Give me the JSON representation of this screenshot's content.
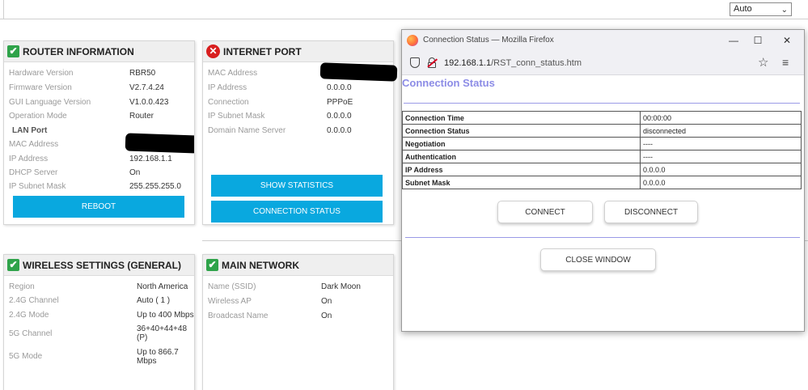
{
  "language_select": {
    "value": "Auto"
  },
  "router_info": {
    "title": "ROUTER INFORMATION",
    "rows": [
      {
        "label": "Hardware Version",
        "value": "RBR50"
      },
      {
        "label": "Firmware Version",
        "value": "V2.7.4.24"
      },
      {
        "label": "GUI Language Version",
        "value": "V1.0.0.423"
      },
      {
        "label": "Operation Mode",
        "value": "Router"
      }
    ],
    "lan_heading": "LAN Port",
    "lan_rows": [
      {
        "label": "MAC Address",
        "value": ""
      },
      {
        "label": "IP Address",
        "value": "192.168.1.1"
      },
      {
        "label": "DHCP Server",
        "value": "On"
      },
      {
        "label": "IP Subnet Mask",
        "value": "255.255.255.0"
      }
    ],
    "reboot_label": "REBOOT"
  },
  "internet_port": {
    "title": "INTERNET PORT",
    "rows": [
      {
        "label": "MAC Address",
        "value": ""
      },
      {
        "label": "IP Address",
        "value": "0.0.0.0"
      },
      {
        "label": "Connection",
        "value": "PPPoE"
      },
      {
        "label": "IP Subnet Mask",
        "value": "0.0.0.0"
      },
      {
        "label": "Domain Name Server",
        "value": "0.0.0.0"
      }
    ],
    "show_statistics_label": "SHOW STATISTICS",
    "connection_status_label": "CONNECTION STATUS"
  },
  "wireless": {
    "title": "WIRELESS SETTINGS (GENERAL)",
    "rows": [
      {
        "label": "Region",
        "value": "North America"
      },
      {
        "label": "2.4G Channel",
        "value": "Auto ( 1 )"
      },
      {
        "label": "2.4G Mode",
        "value": "Up to 400 Mbps"
      },
      {
        "label": "5G Channel",
        "value": "36+40+44+48(P)"
      },
      {
        "label": "5G Mode",
        "value": "Up to 866.7 Mbps"
      }
    ]
  },
  "main_network": {
    "title": "MAIN NETWORK",
    "rows": [
      {
        "label": "Name (SSID)",
        "value": "Dark Moon"
      },
      {
        "label": "Wireless AP",
        "value": "On"
      },
      {
        "label": "Broadcast Name",
        "value": "On"
      }
    ]
  },
  "firefox": {
    "window_title": "Connection Status — Mozilla Firefox",
    "url_host": "192.168.1.1",
    "url_path": "/RST_conn_status.htm",
    "page_title": "Connection Status",
    "table": [
      {
        "key": "Connection Time",
        "value": "00:00:00"
      },
      {
        "key": "Connection Status",
        "value": "disconnected"
      },
      {
        "key": "Negotiation",
        "value": "----"
      },
      {
        "key": "Authentication",
        "value": "----"
      },
      {
        "key": "IP Address",
        "value": "0.0.0.0"
      },
      {
        "key": "Subnet Mask",
        "value": "0.0.0.0"
      }
    ],
    "connect_label": "CONNECT",
    "disconnect_label": "DISCONNECT",
    "close_label": "CLOSE WINDOW"
  },
  "icons": {
    "ok": "check-icon",
    "error": "error-x-icon"
  },
  "colors": {
    "accent_blue": "#09a8df",
    "ok_green": "#2fa34a",
    "error_red": "#d81e1e",
    "cs_purple": "#8c8ce6"
  }
}
